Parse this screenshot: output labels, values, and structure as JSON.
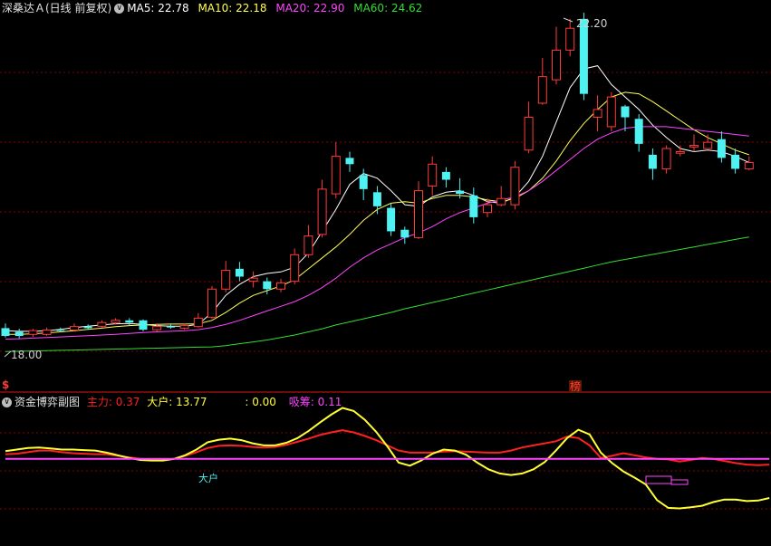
{
  "colors": {
    "background": "#000000",
    "grid": "#8b0000",
    "up": "#ff3b3b",
    "down": "#4ff2f2",
    "ma5": "#ffffff",
    "ma10": "#ffff55",
    "ma20": "#ff44ff",
    "ma60": "#33dd33",
    "main_force": "#ff2020",
    "big_holder": "#ffff33",
    "absorb": "#ff44ff",
    "text_gray": "#c8c8c8"
  },
  "header": {
    "title": "深桑达Ａ(日线 前复权)",
    "menu_icon": "chevron-down-icon",
    "ma5": {
      "label": "MA5:",
      "value": "22.78"
    },
    "ma10": {
      "label": "MA10:",
      "value": "22.18"
    },
    "ma20": {
      "label": "MA20:",
      "value": "22.90"
    },
    "ma60": {
      "label": "MA60:",
      "value": "24.62"
    }
  },
  "main_chart": {
    "high_label": "22.20",
    "low_label": "18.00",
    "marker_left": "$",
    "marker_bang": "榜"
  },
  "sub_panel": {
    "title": "资金博弈副图",
    "main_force": {
      "label": "主力:",
      "value": "0.37"
    },
    "big_holder": {
      "label": "大户:",
      "value": "13.77"
    },
    "blank": {
      "label": ":",
      "value": "0.00"
    },
    "absorb": {
      "label": "吸筹:",
      "value": "0.11"
    },
    "big_holder_marker": "大户"
  },
  "chart_data": [
    {
      "type": "candlestick",
      "title": "深桑达Ａ(日线 前复权)",
      "high_label": 22.2,
      "low_label": 18.0,
      "candles": [
        [
          0.8,
          0.55,
          0.95,
          0.5
        ],
        [
          0.68,
          0.55,
          0.78,
          0.48
        ],
        [
          0.6,
          0.72,
          0.78,
          0.52
        ],
        [
          0.6,
          0.74,
          0.82,
          0.55
        ],
        [
          0.74,
          0.72,
          0.82,
          0.68
        ],
        [
          0.74,
          0.85,
          0.95,
          0.7
        ],
        [
          0.85,
          0.8,
          0.92,
          0.75
        ],
        [
          0.86,
          0.98,
          1.05,
          0.82
        ],
        [
          0.98,
          1.05,
          1.12,
          0.92
        ],
        [
          1.05,
          0.98,
          1.12,
          0.9
        ],
        [
          1.05,
          0.75,
          1.08,
          0.7
        ],
        [
          0.75,
          0.85,
          0.95,
          0.7
        ],
        [
          0.85,
          0.82,
          0.92,
          0.78
        ],
        [
          0.8,
          0.88,
          0.95,
          0.75
        ],
        [
          0.85,
          1.12,
          1.28,
          0.82
        ],
        [
          1.15,
          2.05,
          2.15,
          1.1
        ],
        [
          2.05,
          2.65,
          2.95,
          1.95
        ],
        [
          2.7,
          2.45,
          2.92,
          2.3
        ],
        [
          2.3,
          2.4,
          2.62,
          2.1
        ],
        [
          2.3,
          2.05,
          2.42,
          1.88
        ],
        [
          2.05,
          2.25,
          2.38,
          1.95
        ],
        [
          2.3,
          3.15,
          3.35,
          2.2
        ],
        [
          3.15,
          3.75,
          4.1,
          3.05
        ],
        [
          3.8,
          5.25,
          5.55,
          3.7
        ],
        [
          5.1,
          6.3,
          6.75,
          4.95
        ],
        [
          6.25,
          6.05,
          6.45,
          5.8
        ],
        [
          5.7,
          5.25,
          5.9,
          4.9
        ],
        [
          5.15,
          4.7,
          5.35,
          4.45
        ],
        [
          4.65,
          3.9,
          4.8,
          3.75
        ],
        [
          3.95,
          3.7,
          4.05,
          3.5
        ],
        [
          3.7,
          5.2,
          5.5,
          3.65
        ],
        [
          5.35,
          6.05,
          6.3,
          5.05
        ],
        [
          5.8,
          5.55,
          5.95,
          5.3
        ],
        [
          5.2,
          5.1,
          5.6,
          4.95
        ],
        [
          5.05,
          4.35,
          5.3,
          4.15
        ],
        [
          4.5,
          4.75,
          4.95,
          4.35
        ],
        [
          4.75,
          4.95,
          5.35,
          4.7
        ],
        [
          4.75,
          5.95,
          6.15,
          4.6
        ],
        [
          6.5,
          7.55,
          8.05,
          6.4
        ],
        [
          8.0,
          8.85,
          9.45,
          7.95
        ],
        [
          8.75,
          9.7,
          10.45,
          8.6
        ],
        [
          9.7,
          10.4,
          10.7,
          9.5
        ],
        [
          10.7,
          8.3,
          10.9,
          8.1
        ],
        [
          7.55,
          7.8,
          8.25,
          7.1
        ],
        [
          7.25,
          8.2,
          8.35,
          7.1
        ],
        [
          7.9,
          7.55,
          7.95,
          7.1
        ],
        [
          7.5,
          6.7,
          7.65,
          6.45
        ],
        [
          6.35,
          5.9,
          6.55,
          5.55
        ],
        [
          5.9,
          6.55,
          6.65,
          5.75
        ],
        [
          6.4,
          6.45,
          6.65,
          6.3
        ],
        [
          6.6,
          6.65,
          7.0,
          6.45
        ],
        [
          6.55,
          6.75,
          7.0,
          6.55
        ],
        [
          6.85,
          6.25,
          7.1,
          6.1
        ],
        [
          6.35,
          5.9,
          6.55,
          5.75
        ],
        [
          5.9,
          6.1,
          6.3,
          5.85
        ]
      ],
      "series": [
        {
          "name": "MA5",
          "values": [
            0.72,
            0.7,
            0.7,
            0.72,
            0.76,
            0.82,
            0.86,
            0.9,
            0.94,
            0.95,
            0.92,
            0.88,
            0.86,
            0.86,
            0.92,
            1.3,
            1.85,
            2.2,
            2.45,
            2.55,
            2.6,
            2.75,
            3.2,
            3.9,
            4.6,
            5.4,
            5.75,
            5.6,
            5.2,
            4.75,
            4.7,
            5.0,
            5.15,
            5.2,
            5.05,
            4.85,
            4.8,
            5.0,
            5.5,
            6.3,
            7.4,
            8.5,
            9.1,
            9.2,
            8.6,
            8.2,
            7.8,
            7.3,
            6.9,
            6.55,
            6.45,
            6.5,
            6.45,
            6.3,
            6.1
          ]
        },
        {
          "name": "MA10",
          "values": [
            0.6,
            0.6,
            0.62,
            0.65,
            0.68,
            0.72,
            0.76,
            0.8,
            0.85,
            0.88,
            0.9,
            0.92,
            0.93,
            0.93,
            0.94,
            1.05,
            1.3,
            1.6,
            1.85,
            2.0,
            2.15,
            2.35,
            2.7,
            3.05,
            3.4,
            3.8,
            4.25,
            4.6,
            4.8,
            4.85,
            4.8,
            4.95,
            5.05,
            5.05,
            5.0,
            4.9,
            4.85,
            4.95,
            5.2,
            5.6,
            6.15,
            6.8,
            7.35,
            7.8,
            8.2,
            8.35,
            8.3,
            8.05,
            7.75,
            7.45,
            7.15,
            6.9,
            6.7,
            6.5,
            6.35
          ]
        },
        {
          "name": "MA20",
          "values": [
            0.45,
            0.46,
            0.48,
            0.5,
            0.52,
            0.54,
            0.56,
            0.58,
            0.6,
            0.63,
            0.66,
            0.68,
            0.7,
            0.72,
            0.75,
            0.82,
            0.92,
            1.05,
            1.2,
            1.35,
            1.5,
            1.65,
            1.85,
            2.1,
            2.4,
            2.75,
            3.05,
            3.3,
            3.5,
            3.7,
            3.85,
            4.05,
            4.3,
            4.5,
            4.65,
            4.8,
            4.9,
            5.0,
            5.2,
            5.5,
            5.85,
            6.2,
            6.55,
            6.85,
            7.05,
            7.2,
            7.25,
            7.25,
            7.25,
            7.2,
            7.15,
            7.1,
            7.05,
            7.0,
            6.95
          ]
        },
        {
          "name": "MA60",
          "values": [
            0.05,
            0.06,
            0.07,
            0.08,
            0.09,
            0.1,
            0.11,
            0.12,
            0.13,
            0.14,
            0.15,
            0.16,
            0.17,
            0.18,
            0.19,
            0.2,
            0.24,
            0.3,
            0.36,
            0.42,
            0.5,
            0.58,
            0.68,
            0.78,
            0.9,
            1.0,
            1.1,
            1.2,
            1.3,
            1.42,
            1.52,
            1.62,
            1.72,
            1.82,
            1.92,
            2.02,
            2.12,
            2.22,
            2.32,
            2.42,
            2.52,
            2.62,
            2.72,
            2.82,
            2.92,
            3.0,
            3.08,
            3.16,
            3.24,
            3.32,
            3.4,
            3.48,
            3.56,
            3.64,
            3.72
          ]
        }
      ]
    },
    {
      "type": "line",
      "title": "资金博弈副图",
      "series": [
        {
          "name": "主力",
          "values": [
            2.9,
            2.95,
            3.1,
            3.25,
            3.25,
            3.1,
            3.0,
            2.95,
            2.9,
            2.9,
            2.75,
            2.6,
            2.45,
            2.35,
            2.3,
            2.45,
            2.75,
            3.1,
            3.5,
            3.7,
            3.75,
            3.7,
            3.6,
            3.55,
            3.6,
            3.8,
            4.1,
            4.4,
            4.75,
            5.0,
            5.2,
            5.0,
            4.65,
            4.25,
            3.75,
            3.25,
            3.05,
            3.05,
            3.05,
            3.15,
            3.2,
            3.15,
            3.1,
            3.05,
            3.05,
            3.25,
            3.55,
            3.75,
            3.95,
            4.15,
            4.6,
            4.45,
            3.75,
            2.55,
            2.75,
            3.0,
            2.8,
            2.6,
            2.45,
            2.4,
            2.2,
            2.35,
            2.55,
            2.45,
            2.25,
            2.05,
            1.9,
            1.85,
            1.9
          ]
        },
        {
          "name": "大户",
          "values": [
            3.2,
            3.35,
            3.5,
            3.55,
            3.45,
            3.35,
            3.35,
            3.3,
            3.25,
            3.05,
            2.8,
            2.55,
            2.35,
            2.3,
            2.3,
            2.45,
            2.8,
            3.35,
            4.05,
            4.3,
            4.4,
            4.25,
            3.95,
            3.75,
            3.75,
            4.0,
            4.45,
            5.15,
            5.95,
            6.7,
            7.35,
            7.05,
            6.2,
            5.05,
            3.65,
            2.1,
            1.8,
            2.3,
            2.95,
            3.35,
            3.25,
            2.85,
            2.1,
            1.45,
            1.05,
            0.9,
            1.05,
            1.45,
            2.15,
            3.25,
            4.45,
            5.25,
            4.8,
            3.05,
            2.05,
            1.25,
            0.65,
            0.0,
            -1.5,
            -2.25,
            -2.3,
            -2.2,
            -2.05,
            -1.7,
            -1.45,
            -1.45,
            -1.6,
            -1.55,
            -1.3
          ]
        },
        {
          "name": "吸筹",
          "values": [
            2.45,
            2.45,
            2.45,
            2.45,
            2.45,
            2.45,
            2.45,
            2.45,
            2.45,
            2.45,
            2.45,
            2.45,
            2.45,
            2.45,
            2.45,
            2.45,
            2.45,
            2.45,
            2.45,
            2.45,
            2.45,
            2.45,
            2.45,
            2.45,
            2.45,
            2.45,
            2.45,
            2.45,
            2.45,
            2.45,
            2.45,
            2.45,
            2.45,
            2.45,
            2.45,
            2.45,
            2.45,
            2.45,
            2.45,
            2.45,
            2.45,
            2.45,
            2.45,
            2.45,
            2.45,
            2.45,
            2.45,
            2.45,
            2.45,
            2.45,
            2.45,
            2.45,
            2.45,
            2.45,
            2.45,
            2.45,
            2.45,
            2.45,
            2.45,
            2.45,
            2.45,
            2.45,
            2.45,
            2.45,
            2.45,
            2.45,
            2.45,
            2.45,
            2.45
          ]
        }
      ]
    }
  ]
}
